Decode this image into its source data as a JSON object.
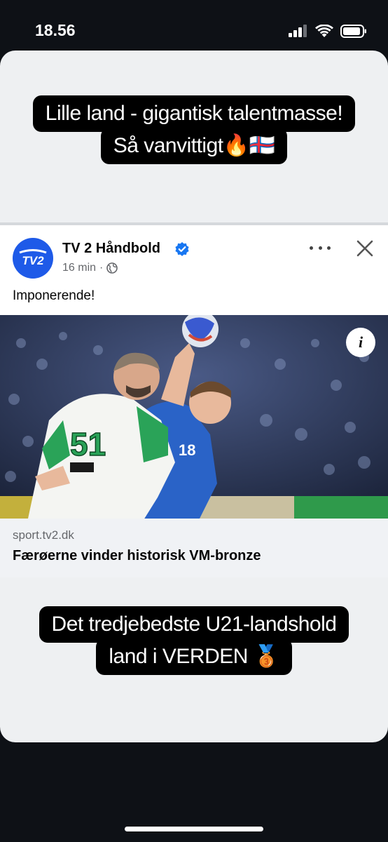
{
  "status": {
    "time": "18.56",
    "icons": [
      "cellular-signal-icon",
      "wifi-icon",
      "battery-icon"
    ]
  },
  "story": {
    "caption_top": {
      "line1": "Lille land - gigantisk talentmasse!",
      "line2": "Så vanvittigt🔥🇫🇴"
    },
    "caption_bottom": {
      "line1": "Det tredjebedste U21-landshold",
      "line2": "land i VERDEN 🥉"
    }
  },
  "post": {
    "page_name": "TV 2 Håndbold",
    "avatar_text": "TV2",
    "time_ago": "16 min",
    "separator": "·",
    "body_text": "Imponerende!",
    "image_alt": "Handball players in blue and white jerseys during match",
    "info_label": "i",
    "link": {
      "domain": "sport.tv2.dk",
      "title": "Færøerne vinder historisk VM-bronze"
    },
    "jersey_numbers": [
      "51",
      "18"
    ]
  },
  "colors": {
    "accent": "#1e5ae8",
    "verified": "#1877f2",
    "background": "#0e1116",
    "card": "#eef0f2"
  }
}
